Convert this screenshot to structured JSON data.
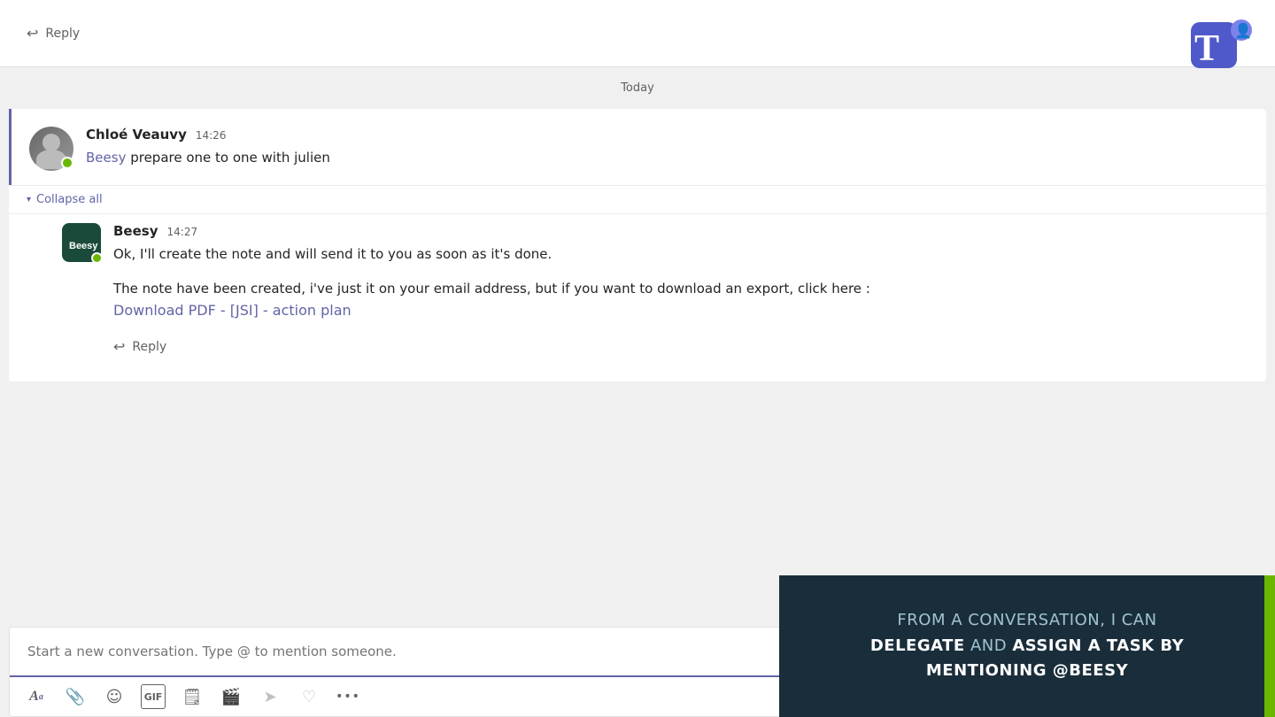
{
  "teams_logo": {
    "alt": "Microsoft Teams"
  },
  "top_reply": {
    "label": "Reply"
  },
  "date_separator": {
    "text": "Today"
  },
  "main_message": {
    "sender": "Chloé Veauvy",
    "time": "14:26",
    "mention": "Beesy",
    "text": " prepare one to one with julien"
  },
  "collapse_link": {
    "label": "Collapse all"
  },
  "reply_message": {
    "sender": "Beesy",
    "time": "14:27",
    "text1": "Ok, I'll create the note and will send it to you as soon as it's done.",
    "text2": "The note have been created, i've just it on your email address, but if you want to download an export, click here :",
    "link_text": "Download PDF - [JSI] - action plan"
  },
  "bottom_reply": {
    "label": "Reply"
  },
  "input": {
    "placeholder": "Start a new conversation. Type @ to mention someone."
  },
  "toolbar": {
    "icons": [
      {
        "name": "format-icon",
        "symbol": "A"
      },
      {
        "name": "attach-icon",
        "symbol": "📎"
      },
      {
        "name": "emoji-icon",
        "symbol": "☺"
      },
      {
        "name": "gif-icon",
        "symbol": "GIF"
      },
      {
        "name": "sticker-icon",
        "symbol": "🗒"
      },
      {
        "name": "video-icon",
        "symbol": "⏹"
      },
      {
        "name": "send-icon",
        "symbol": "➤"
      },
      {
        "name": "like-icon",
        "symbol": "♡"
      },
      {
        "name": "more-icon",
        "symbol": "···"
      }
    ]
  },
  "promo": {
    "line1": "FROM A CONVERSATION, I CAN",
    "bold1": "DELEGATE",
    "line2": " AND ",
    "bold2": "ASSIGN A TASK BY",
    "line3": "MENTIONING @BEESY"
  }
}
